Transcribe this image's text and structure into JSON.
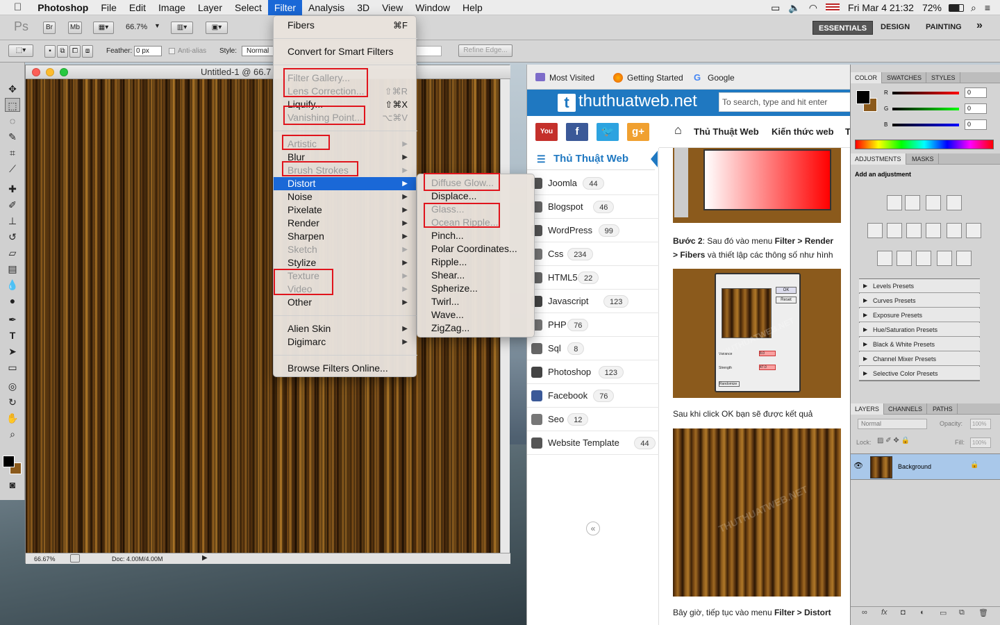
{
  "menubar": {
    "apple_icon": "apple-icon",
    "items": [
      "Photoshop",
      "File",
      "Edit",
      "Image",
      "Layer",
      "Select",
      "Filter",
      "Analysis",
      "3D",
      "View",
      "Window",
      "Help"
    ],
    "active": "Filter",
    "clock": "Fri Mar 4  21:32",
    "battery": "72%"
  },
  "ps_appbar": {
    "logo": "Ps",
    "br": "Br",
    "mb": "Mb",
    "zoom": "66.7%",
    "workspaces": [
      "ESSENTIALS",
      "DESIGN",
      "PAINTING"
    ],
    "more": "»"
  },
  "ps_options": {
    "feather_label": "Feather:",
    "feather_value": "0 px",
    "antialias": "Anti-alias",
    "style_label": "Style:",
    "style_value": "Normal",
    "refine_edge": "Refine Edge..."
  },
  "document": {
    "title": "Untitled-1 @ 66.7",
    "zoom": "66.67%",
    "doc_size": "Doc: 4.00M/4.00M"
  },
  "filter_menu": {
    "items": [
      {
        "label": "Fibers",
        "shortcut": "⌘F",
        "disabled": false
      },
      {
        "label": "Convert for Smart Filters",
        "disabled": false
      },
      {
        "label": "Filter Gallery...",
        "disabled": true
      },
      {
        "label": "Lens Correction...",
        "shortcut": "⇧⌘R",
        "disabled": true
      },
      {
        "label": "Liquify...",
        "shortcut": "⇧⌘X",
        "disabled": false
      },
      {
        "label": "Vanishing Point...",
        "shortcut": "⌥⌘V",
        "disabled": true
      },
      {
        "label": "Artistic",
        "disabled": true
      },
      {
        "label": "Blur",
        "disabled": false
      },
      {
        "label": "Brush Strokes",
        "disabled": true
      },
      {
        "label": "Distort",
        "disabled": false,
        "selected": true
      },
      {
        "label": "Noise",
        "disabled": false
      },
      {
        "label": "Pixelate",
        "disabled": false
      },
      {
        "label": "Render",
        "disabled": false
      },
      {
        "label": "Sharpen",
        "disabled": false
      },
      {
        "label": "Sketch",
        "disabled": true
      },
      {
        "label": "Stylize",
        "disabled": false
      },
      {
        "label": "Texture",
        "disabled": true
      },
      {
        "label": "Video",
        "disabled": true
      },
      {
        "label": "Other",
        "disabled": false
      },
      {
        "label": "Alien Skin",
        "disabled": false
      },
      {
        "label": "Digimarc",
        "disabled": false
      },
      {
        "label": "Browse Filters Online...",
        "disabled": false
      }
    ]
  },
  "distort_menu": {
    "items": [
      {
        "label": "Diffuse Glow...",
        "disabled": true
      },
      {
        "label": "Displace...",
        "disabled": false
      },
      {
        "label": "Glass...",
        "disabled": true
      },
      {
        "label": "Ocean Ripple...",
        "disabled": true
      },
      {
        "label": "Pinch...",
        "disabled": false
      },
      {
        "label": "Polar Coordinates...",
        "disabled": false
      },
      {
        "label": "Ripple...",
        "disabled": false
      },
      {
        "label": "Shear...",
        "disabled": false
      },
      {
        "label": "Spherize...",
        "disabled": false
      },
      {
        "label": "Twirl...",
        "disabled": false
      },
      {
        "label": "Wave...",
        "disabled": false
      },
      {
        "label": "ZigZag...",
        "disabled": false
      }
    ]
  },
  "browser": {
    "bookmarks": [
      "Most Visited",
      "Getting Started",
      "Google"
    ],
    "site_name": "thuthuatweb.net",
    "logo_letter": "t",
    "search_placeholder": "To search, type and hit enter",
    "social": [
      "You",
      "f",
      "t",
      "g+"
    ],
    "nav": [
      "Thủ Thuật Web",
      "Kiến thức web",
      "T"
    ],
    "sidebar_title": "Thủ Thuật Web",
    "categories": [
      {
        "name": "Joomla",
        "count": "44"
      },
      {
        "name": "Blogspot",
        "count": "46"
      },
      {
        "name": "WordPress",
        "count": "99"
      },
      {
        "name": "Css",
        "count": "234"
      },
      {
        "name": "HTML5",
        "count": "22"
      },
      {
        "name": "Javascript",
        "count": "123"
      },
      {
        "name": "PHP",
        "count": "76"
      },
      {
        "name": "Sql",
        "count": "8"
      },
      {
        "name": "Photoshop",
        "count": "123"
      },
      {
        "name": "Facebook",
        "count": "76"
      },
      {
        "name": "Seo",
        "count": "12"
      },
      {
        "name": "Website Template",
        "count": "44"
      }
    ],
    "collapse": "«",
    "step2_b": "Bước 2",
    "step2_text": ": Sau đó vào menu ",
    "step2_filter": "Filter",
    "step2_gt": " > ",
    "step2_render": "Render",
    "step2_line2_gt": "> ",
    "step2_fibers": "Fibers",
    "step2_rest": " và thiết lập các thông số như hình",
    "after_ok": "Sau khi click OK bạn sẽ được kết quả",
    "next_text": "Bây giờ, tiếp tục vào menu ",
    "next_filter": "Filter",
    "next_gt": " > ",
    "next_distort": "Distort",
    "watermark": "THUTHUATWEB.NET",
    "dlg_ok": "OK",
    "dlg_reset": "Reset",
    "dlg_variance": "Variance",
    "dlg_strength": "Strength",
    "dlg_randomize": "Randomize",
    "dlg_variance_val": "8.0",
    "dlg_strength_val": "47.0"
  },
  "panels": {
    "color_tabs": [
      "COLOR",
      "SWATCHES",
      "STYLES"
    ],
    "rgb": [
      {
        "ch": "R",
        "val": "0"
      },
      {
        "ch": "G",
        "val": "0"
      },
      {
        "ch": "B",
        "val": "0"
      }
    ],
    "adj_tabs": [
      "ADJUSTMENTS",
      "MASKS"
    ],
    "add_adjustment": "Add an adjustment",
    "presets": [
      "Levels Presets",
      "Curves Presets",
      "Exposure Presets",
      "Hue/Saturation Presets",
      "Black & White Presets",
      "Channel Mixer Presets",
      "Selective Color Presets"
    ],
    "layer_tabs": [
      "LAYERS",
      "CHANNELS",
      "PATHS"
    ],
    "blend_mode": "Normal",
    "opacity_label": "Opacity:",
    "opacity_value": "100%",
    "lock_label": "Lock:",
    "fill_label": "Fill:",
    "fill_value": "100%",
    "layer_name": "Background"
  },
  "colors": {
    "accent": "#1a68d7",
    "site_blue": "#1f78c1",
    "highlight_red": "#e0141c",
    "wood": "#7a4a14"
  }
}
